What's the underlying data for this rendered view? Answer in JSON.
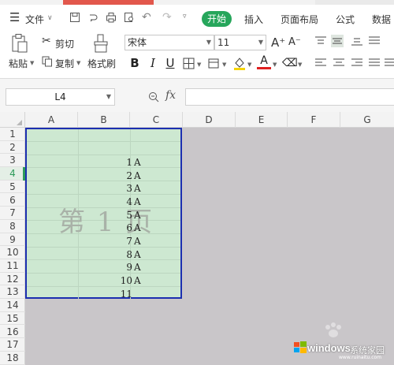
{
  "menubar": {
    "file_label": "文件",
    "tabs": [
      "开始",
      "插入",
      "页面布局",
      "公式",
      "数据"
    ]
  },
  "ribbon": {
    "paste_label": "粘贴",
    "cut_label": "剪切",
    "copy_label": "复制",
    "format_painter_label": "格式刷",
    "font_name": "宋体",
    "font_size": "11"
  },
  "formulabar": {
    "cell_ref": "L4",
    "fx_label": "fx",
    "formula_value": ""
  },
  "sheet": {
    "columns": [
      "A",
      "B",
      "C",
      "D",
      "E",
      "F",
      "G"
    ],
    "rows": [
      "1",
      "2",
      "3",
      "4",
      "5",
      "6",
      "7",
      "8",
      "9",
      "10",
      "11",
      "12",
      "13",
      "14",
      "15",
      "16",
      "17",
      "18"
    ],
    "active_row": "4",
    "page_watermark": "第 1 页",
    "cells": [
      {
        "num": "1",
        "val": "A"
      },
      {
        "num": "2",
        "val": "A"
      },
      {
        "num": "3",
        "val": "A"
      },
      {
        "num": "4",
        "val": "A"
      },
      {
        "num": "5",
        "val": "A"
      },
      {
        "num": "6",
        "val": "A"
      },
      {
        "num": "7",
        "val": "A"
      },
      {
        "num": "8",
        "val": "A"
      },
      {
        "num": "9",
        "val": "A"
      },
      {
        "num": "10",
        "val": "A"
      },
      {
        "num": "11",
        "val": ""
      }
    ]
  },
  "site_watermark": {
    "brand": "windows",
    "suffix": "系统家园",
    "url": "www.ruinaitu.com"
  },
  "colors": {
    "accent_green": "#26a65b",
    "print_area_fill": "#cde8d1",
    "print_area_border": "#1c2fb0",
    "grid_background": "#c9c6c9"
  }
}
